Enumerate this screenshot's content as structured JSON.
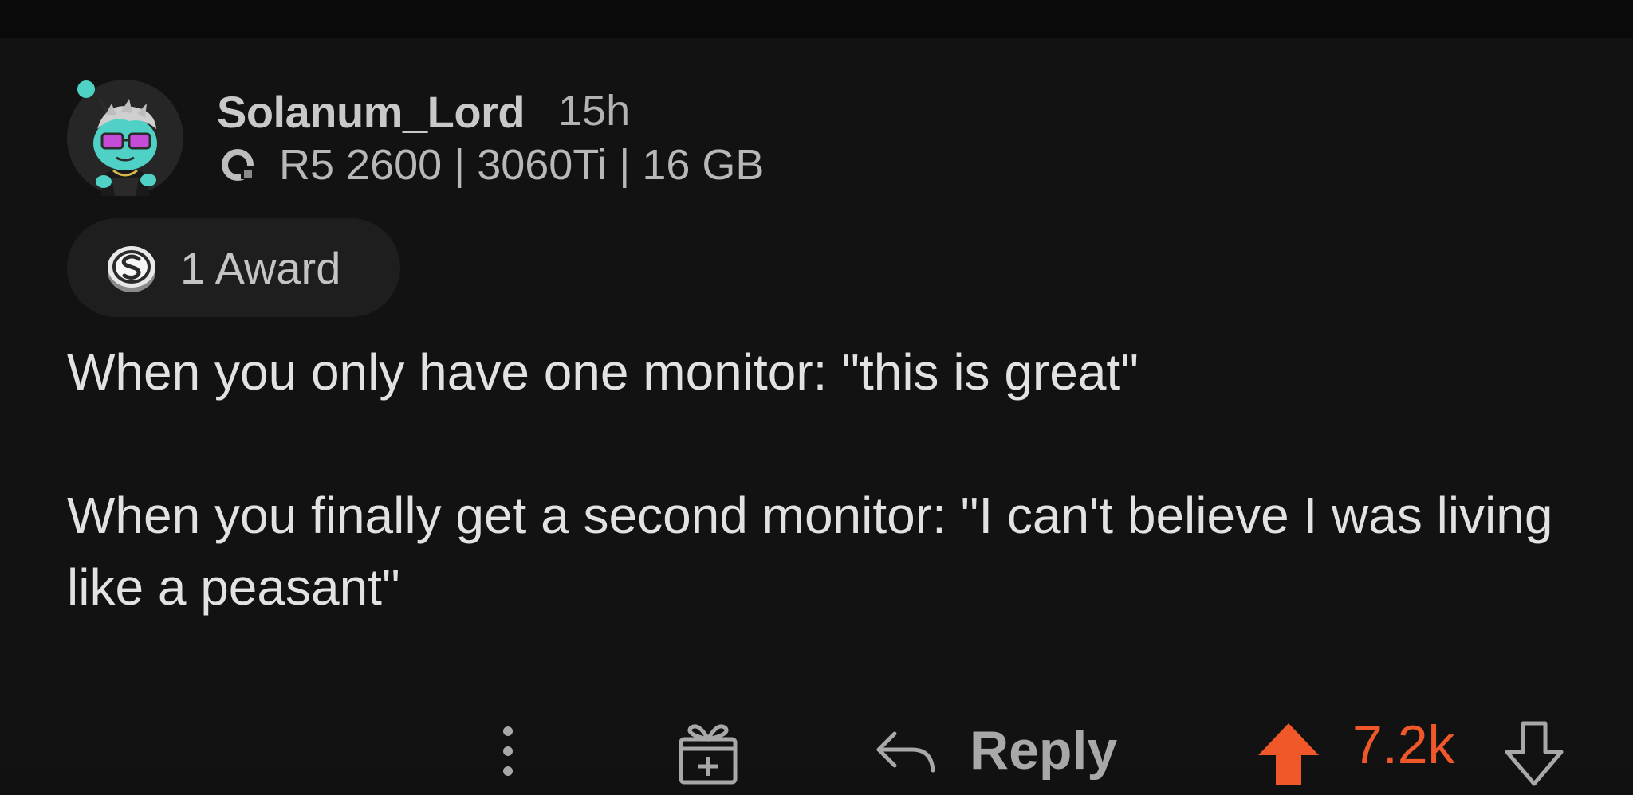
{
  "comment": {
    "author": "Solanum_Lord",
    "age": "15h",
    "flair": "R5 2600 | 3060Ti | 16 GB",
    "awards_label": "1 Award",
    "paragraphs": [
      "When you only have one monitor: \"this is great\"",
      "When you finally get a second monitor: \"I can't believe I was living like a peasant\""
    ]
  },
  "actions": {
    "more_icon": "more-vertical-icon",
    "gift_icon": "gift-award-icon",
    "reply_icon": "reply-arrow-icon",
    "reply_label": "Reply",
    "upvote_icon": "upvote-arrow-icon",
    "score": "7.2k",
    "downvote_icon": "downvote-arrow-icon"
  },
  "colors": {
    "background": "#121212",
    "text": "#e2e2e2",
    "muted": "#a8a8a8",
    "upvote_accent": "#f0582a",
    "award_pill": "#1e1e1e"
  }
}
